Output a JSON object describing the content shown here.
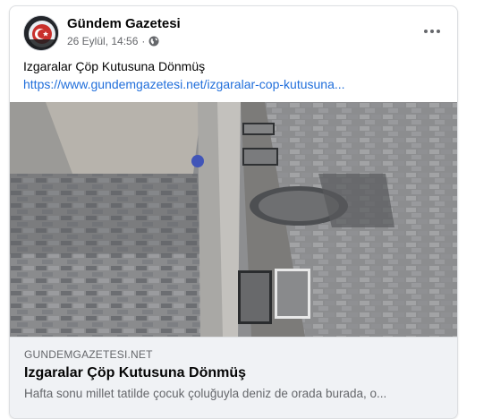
{
  "post": {
    "page_name": "Gündem Gazetesi",
    "timestamp": "26 Eylül, 14:56",
    "separator": "·",
    "audience_icon": "globe-icon",
    "more_icon": "more-options-icon",
    "text": "Izgaralar Çöp Kutusuna Dönmüş",
    "link_text": "https://www.gundemgazetesi.net/izgaralar-cop-kutusuna...",
    "image_subject": "street drainage grates between cobblestone paving"
  },
  "link_preview": {
    "domain": "GUNDEMGAZETESI.NET",
    "title": "Izgaralar Çöp Kutusuna Dönmüş",
    "description": "Hafta sonu millet tatilde çocuk çoluğuyla deniz de orada burada, o..."
  },
  "colors": {
    "link": "#216fdb",
    "text": "#050505",
    "muted": "#65676b",
    "preview_bg": "#f0f2f5"
  }
}
